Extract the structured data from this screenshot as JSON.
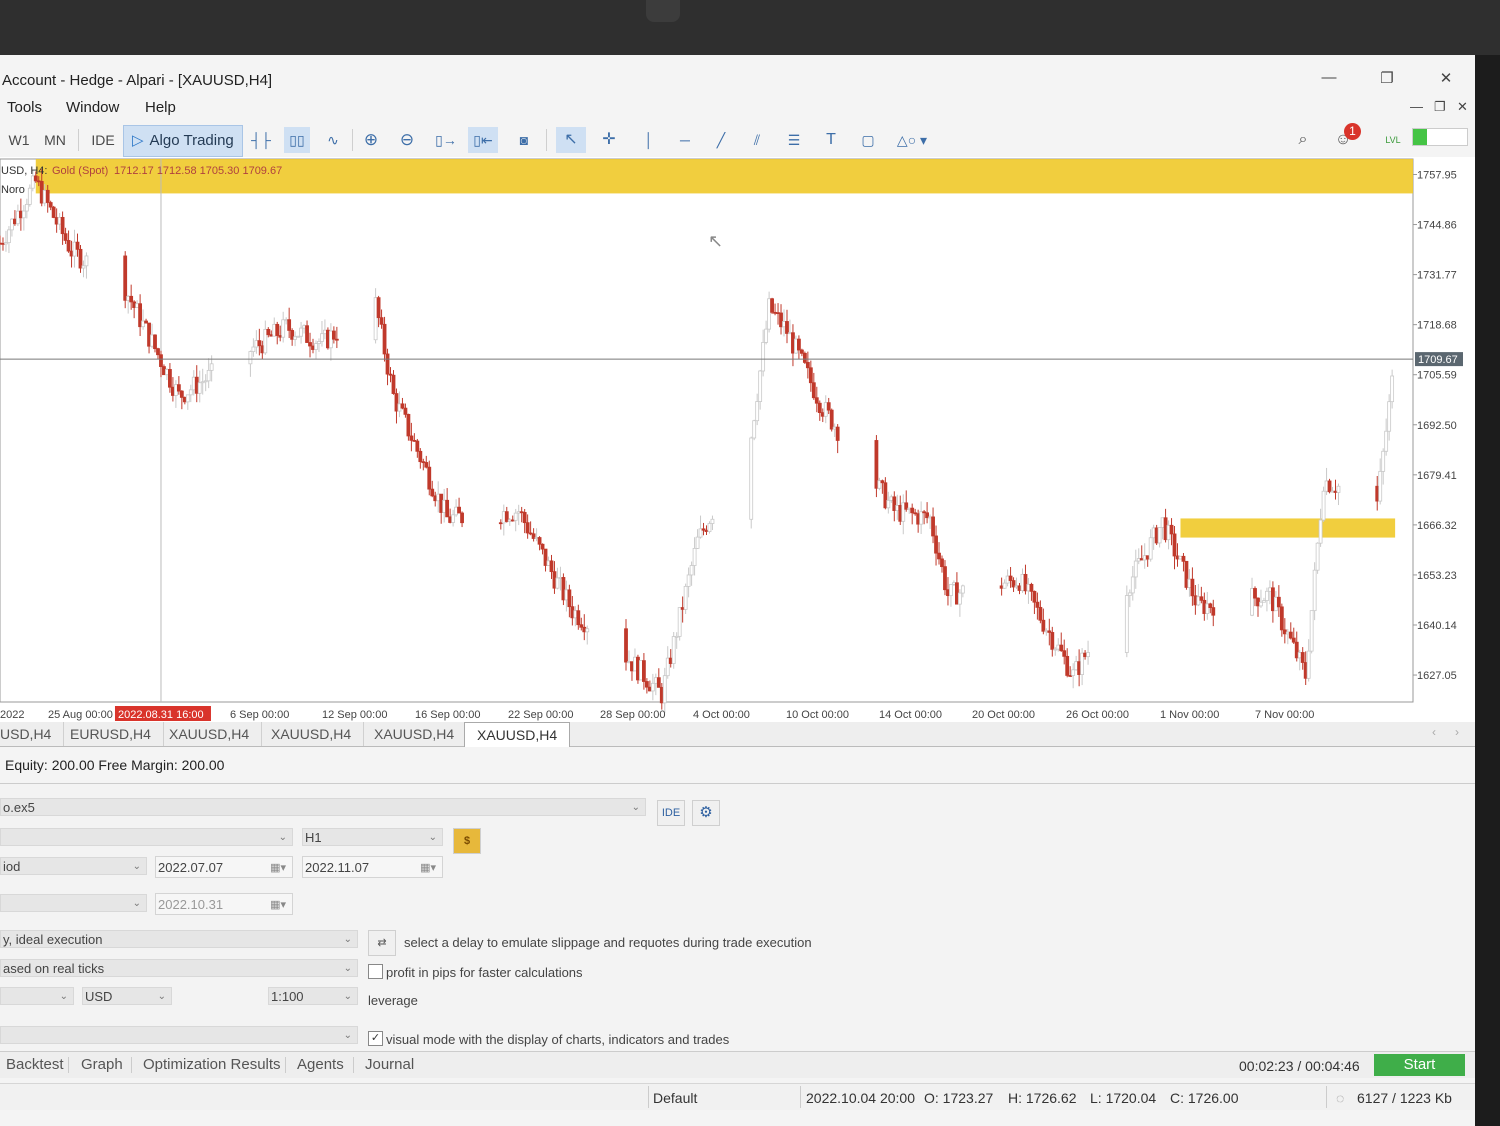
{
  "window": {
    "title": "Account - Hedge - Alpari - [XAUUSD,H4]",
    "controls": [
      "—",
      "❐",
      "✕"
    ]
  },
  "menu": {
    "items": [
      "Tools",
      "Window",
      "Help"
    ]
  },
  "toolbar": {
    "timeframes": [
      "W1",
      "MN"
    ],
    "ide_label": "IDE",
    "algo_trading_label": "Algo Trading",
    "notification_count": "1",
    "level_label": "LVL",
    "level_fill": 0.25
  },
  "chart": {
    "header_symbol": "USD, H4:",
    "header_name": "Gold (Spot)",
    "header_ohlc": "1712.17 1712.58 1705.30 1709.67",
    "indicator_label": "Noro",
    "current_price": "1709.67",
    "price_labels": [
      "1757.95",
      "1744.86",
      "1731.77",
      "1718.68",
      "1705.59",
      "1692.50",
      "1679.41",
      "1666.32",
      "1653.23",
      "1640.14",
      "1627.05"
    ],
    "time_labels": [
      "2022",
      "25 Aug 00:00",
      "6 Sep 00:00",
      "12 Sep 00:00",
      "16 Sep 00:00",
      "22 Sep 00:00",
      "28 Sep 00:00",
      "4 Oct 00:00",
      "10 Oct 00:00",
      "14 Oct 00:00",
      "20 Oct 00:00",
      "26 Oct 00:00",
      "1 Nov 00:00",
      "7 Nov 00:00"
    ],
    "crosshair_time": "2022.08.31 16:00",
    "zone_color": "#f0c929",
    "bull_color": "#c9c9c9",
    "bear_color": "#c0392b"
  },
  "chart_data": {
    "type": "candlestick",
    "title": "XAUUSD, H4 — Gold (Spot)",
    "xlabel": "",
    "ylabel": "",
    "ylim": [
      1620,
      1762
    ],
    "x_range": [
      "2022-08-22",
      "2022-11-09"
    ],
    "last_price": 1709.67,
    "last_ohlc": {
      "open": 1712.17,
      "high": 1712.58,
      "low": 1705.3,
      "close": 1709.67
    },
    "zones": [
      {
        "from": "2022-08-24",
        "to": "2022-11-09",
        "y_low": 1753,
        "y_high": 1766
      },
      {
        "from": "2022-10-27",
        "to": "2022-11-08",
        "y_low": 1663,
        "y_high": 1668
      }
    ],
    "close_path": [
      [
        "2022-08-22",
        1740
      ],
      [
        "2022-08-24",
        1756
      ],
      [
        "2022-08-26",
        1738
      ],
      [
        "2022-08-29",
        1728
      ],
      [
        "2022-09-01",
        1700
      ],
      [
        "2022-09-05",
        1712
      ],
      [
        "2022-09-07",
        1718
      ],
      [
        "2022-09-09",
        1714
      ],
      [
        "2022-09-12",
        1724
      ],
      [
        "2022-09-13",
        1700
      ],
      [
        "2022-09-16",
        1668
      ],
      [
        "2022-09-20",
        1670
      ],
      [
        "2022-09-23",
        1644
      ],
      [
        "2022-09-26",
        1632
      ],
      [
        "2022-09-28",
        1622
      ],
      [
        "2022-09-30",
        1662
      ],
      [
        "2022-10-03",
        1690
      ],
      [
        "2022-10-04",
        1723
      ],
      [
        "2022-10-05",
        1717
      ],
      [
        "2022-10-07",
        1697
      ],
      [
        "2022-10-11",
        1670
      ],
      [
        "2022-10-13",
        1668
      ],
      [
        "2022-10-14",
        1648
      ],
      [
        "2022-10-18",
        1652
      ],
      [
        "2022-10-21",
        1627
      ],
      [
        "2022-10-24",
        1650
      ],
      [
        "2022-10-26",
        1667
      ],
      [
        "2022-10-28",
        1645
      ],
      [
        "2022-11-01",
        1648
      ],
      [
        "2022-11-03",
        1627
      ],
      [
        "2022-11-04",
        1678
      ],
      [
        "2022-11-07",
        1672
      ],
      [
        "2022-11-08",
        1710
      ]
    ]
  },
  "chart_tabs": [
    "USD,H4",
    "EURUSD,H4",
    "XAUUSD,H4",
    "XAUUSD,H4",
    "XAUUSD,H4",
    "XAUUSD,H4"
  ],
  "account": {
    "equity_text": "Equity: 200.00  Free Margin: 200.00"
  },
  "tester": {
    "expert": "o.ex5",
    "ide_label": "IDE",
    "symbol": "",
    "timeframe": "H1",
    "period": "iod",
    "date_from": "2022.07.07",
    "date_to": "2022.11.07",
    "forward": "",
    "forward_date": "2022.10.31",
    "delay": "y, ideal execution",
    "delay_hint": "select a delay to emulate slippage and requotes during trade execution",
    "model": "ased on real ticks",
    "pips_label": "profit in pips for faster calculations",
    "deposit": "",
    "currency": "USD",
    "leverage_value": "1:100",
    "leverage_label": "leverage",
    "optimization": "",
    "visual_label": "visual mode with the display of charts, indicators and trades",
    "visual_checked": true,
    "pips_checked": false
  },
  "bottom_tabs": [
    "Backtest",
    "Graph",
    "Optimization Results",
    "Agents",
    "Journal"
  ],
  "progress": {
    "time": "00:02:23 / 00:04:46",
    "start_label": "Start"
  },
  "status": {
    "profile": "Default",
    "datetime": "2022.10.04 20:00",
    "open": "O: 1723.27",
    "high": "H: 1726.62",
    "low": "L: 1720.04",
    "close": "C: 1726.00",
    "memory": "6127 / 1223 Kb"
  }
}
